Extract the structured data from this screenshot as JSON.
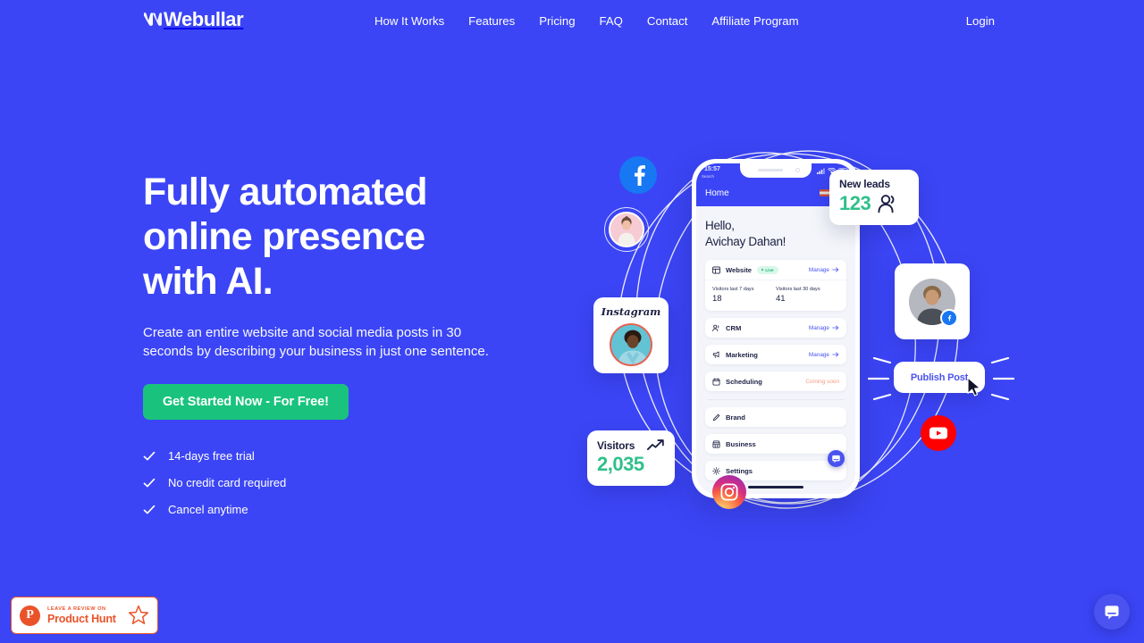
{
  "brand": {
    "name": "Webullar",
    "accent": "#3B45F5",
    "cta_color": "#19C37D",
    "green": "#2FC08A"
  },
  "nav": {
    "links": [
      {
        "label": "How It Works"
      },
      {
        "label": "Features"
      },
      {
        "label": "Pricing"
      },
      {
        "label": "FAQ"
      },
      {
        "label": "Contact"
      },
      {
        "label": "Affiliate Program"
      }
    ],
    "login_label": "Login"
  },
  "hero": {
    "title_line1": "Fully automated",
    "title_line2": "online presence",
    "title_line3": "with AI.",
    "subtitle": "Create an entire website and social media posts in 30 seconds by describing your business in just one sentence.",
    "cta_label": "Get Started Now - For Free!",
    "checks": [
      {
        "label": "14-days free trial"
      },
      {
        "label": "No credit card required"
      },
      {
        "label": "Cancel anytime"
      }
    ]
  },
  "phone": {
    "status_time": "15:57",
    "status_back": "Search",
    "topbar_title": "Home",
    "greeting_line1": "Hello,",
    "greeting_line2": "Avichay Dahan!",
    "website_card": {
      "label": "Website",
      "badge": "Live",
      "action": "Manage",
      "stats": [
        {
          "key": "Visitors last 7 days",
          "value": "18"
        },
        {
          "key": "Visitors last 30 days",
          "value": "41"
        }
      ]
    },
    "rows": [
      {
        "label": "CRM",
        "action": "Manage",
        "state": "manage",
        "icon": "people-icon"
      },
      {
        "label": "Marketing",
        "action": "Manage",
        "state": "manage",
        "icon": "megaphone-icon"
      },
      {
        "label": "Scheduling",
        "action": "Coming soon",
        "state": "soon",
        "icon": "calendar-icon"
      }
    ],
    "rows2": [
      {
        "label": "Brand",
        "icon": "pen-icon"
      },
      {
        "label": "Business",
        "icon": "store-icon"
      },
      {
        "label": "Settings",
        "icon": "gear-icon"
      }
    ]
  },
  "floating": {
    "new_leads": {
      "title": "New leads",
      "value": "123",
      "icon": "people-icon"
    },
    "visitors": {
      "title": "Visitors",
      "value": "2,035",
      "icon": "trend-up-icon"
    },
    "instagram_card": {
      "wordmark": "Instagram"
    },
    "publish": {
      "label": "Publish Post"
    }
  },
  "social": [
    {
      "name": "facebook-icon"
    },
    {
      "name": "youtube-icon"
    },
    {
      "name": "instagram-icon"
    }
  ],
  "product_hunt": {
    "small_label": "LEAVE A REVIEW ON",
    "big_label": "Product Hunt",
    "logo_letter": "P"
  }
}
